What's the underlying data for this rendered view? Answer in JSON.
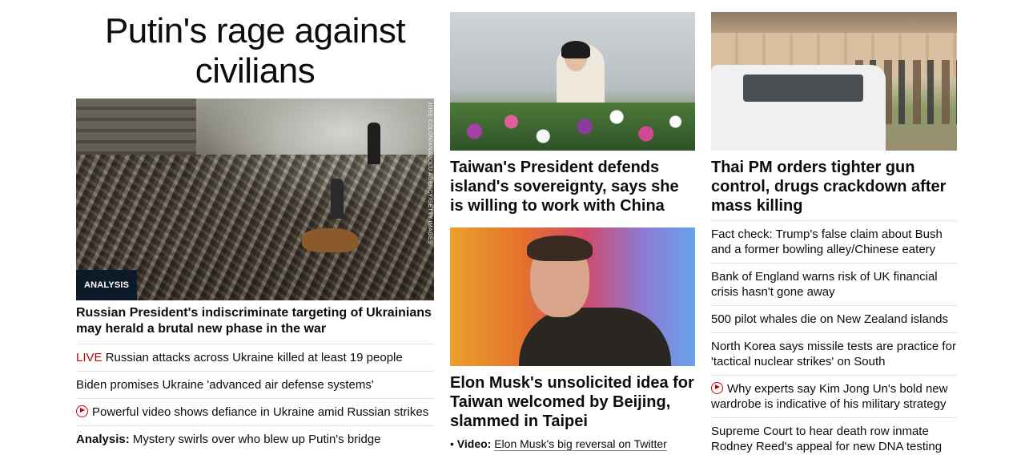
{
  "hero": {
    "headline": "Putin's rage against civilians",
    "image_credit": "JOSE COLON/ANADOLU AGENCY/GETTY IMAGES",
    "tag": "ANALYSIS",
    "subheadline": "Russian President's indiscriminate targeting of Ukrainians may herald a brutal new phase in the war",
    "links": [
      {
        "prefix": "LIVE",
        "text": " Russian attacks across Ukraine killed at least 19 people"
      },
      {
        "prefix": "",
        "text": "Biden promises Ukraine 'advanced air defense systems'"
      },
      {
        "prefix": "",
        "text": "Powerful video shows defiance in Ukraine amid Russian strikes",
        "icon": "play-icon"
      },
      {
        "prefix": "Analysis:",
        "text": " Mystery swirls over who blew up Putin's bridge"
      }
    ]
  },
  "col2": {
    "story1": {
      "headline": "Taiwan's President defends island's sovereignty, says she is willing to work with China"
    },
    "story2": {
      "headline": "Elon Musk's unsolicited idea for Taiwan welcomed by Beijing, slammed in Taipei",
      "video_bullet": "•",
      "video_label": "Video:",
      "video_text": "Elon Musk's big reversal on Twitter"
    }
  },
  "col3": {
    "headline": "Thai PM orders tighter gun control, drugs crackdown after mass killing",
    "stories": [
      {
        "text": "Fact check: Trump's false claim about Bush and a former bowling alley/Chinese eatery"
      },
      {
        "text": "Bank of England warns risk of UK financial crisis hasn't gone away"
      },
      {
        "text": "500 pilot whales die on New Zealand islands"
      },
      {
        "text": "North Korea says missile tests are practice for 'tactical nuclear strikes' on South"
      },
      {
        "text": "Why experts say Kim Jong Un's bold new wardrobe is indicative of his military strategy",
        "icon": "play-icon"
      },
      {
        "text": "Supreme Court to hear death row inmate Rodney Reed's appeal for new DNA testing"
      }
    ]
  },
  "colors": {
    "live_red": "#cc0000",
    "tag_bg": "#0c1a2a",
    "divider": "#e3e3e3"
  }
}
